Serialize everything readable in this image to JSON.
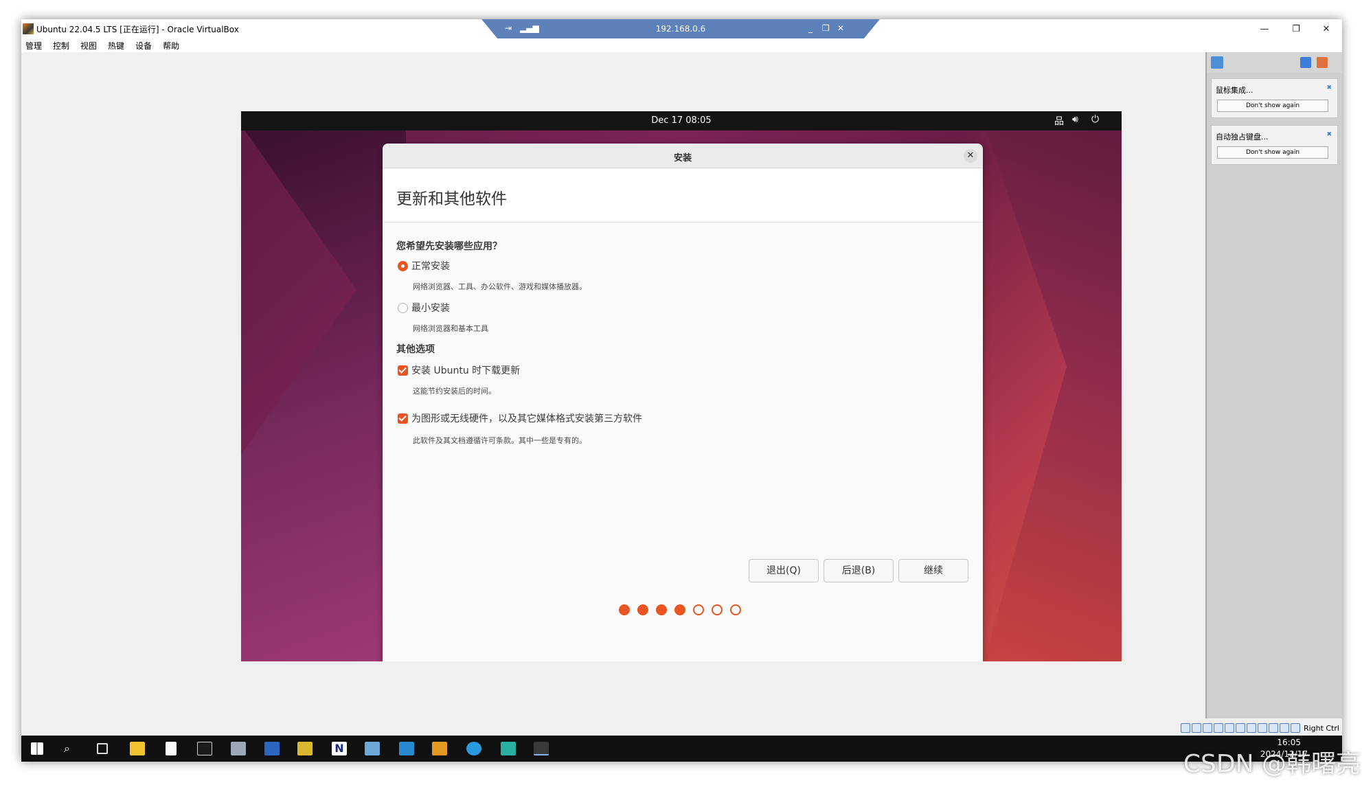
{
  "window": {
    "title": "Ubuntu 22.04.5 LTS [正在运行] - Oracle VirtualBox"
  },
  "menu": [
    "管理",
    "控制",
    "视图",
    "热键",
    "设备",
    "帮助"
  ],
  "remote": {
    "ip": "192.168.0.6"
  },
  "ubuntu": {
    "clock": "Dec 17  08:05"
  },
  "installer": {
    "title": "安装",
    "heading": "更新和其他软件",
    "question": "您希望先安装哪些应用？",
    "options": [
      {
        "label": "正常安装",
        "desc": "网络浏览器、工具、办公软件、游戏和媒体播放器。",
        "selected": true
      },
      {
        "label": "最小安装",
        "desc": "网络浏览器和基本工具",
        "selected": false
      }
    ],
    "other_heading": "其他选项",
    "checks": [
      {
        "label": "安装 Ubuntu 时下载更新",
        "desc": "这能节约安装后的时间。",
        "checked": true
      },
      {
        "label": "为图形或无线硬件，以及其它媒体格式安装第三方软件",
        "desc": "此软件及其文档遵循许可条款。其中一些是专有的。",
        "checked": true
      }
    ],
    "buttons": {
      "quit": "退出(Q)",
      "back": "后退(B)",
      "continue": "继续"
    },
    "progress": {
      "total_steps": 7,
      "completed_steps": 4
    }
  },
  "sidebar": {
    "notices": [
      {
        "title": "鼠标集成...",
        "button": "Don't show again"
      },
      {
        "title": "自动独占键盘...",
        "button": "Don't show again"
      }
    ]
  },
  "status": {
    "host_key": "Right Ctrl"
  },
  "taskbar": {
    "time": "16:05",
    "date": "2024/12/17"
  },
  "watermark": "CSDN @韩曙亮",
  "colors": {
    "ubuntu_orange": "#e95420",
    "remote_bar": "#5d82ba",
    "taskbar": "#101010"
  }
}
